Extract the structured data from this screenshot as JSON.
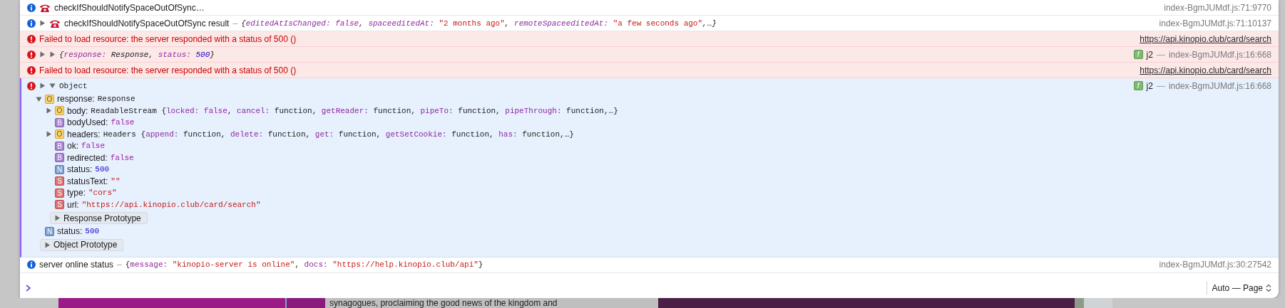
{
  "messages": [
    {
      "kind": "info-emblem",
      "selected": false,
      "label": "checkIfShouldNotifySpaceOutOfSync…",
      "source": {
        "kind": "location",
        "text": "index-BgmJUMdf.js:71:9770"
      }
    },
    {
      "kind": "info-emblem",
      "selected": false,
      "expanded": false,
      "label": "checkIfShouldNotifySpaceOutOfSync result",
      "separator": "–",
      "italic": true,
      "preview": [
        {
          "kind": "punct",
          "text": "{"
        },
        {
          "kind": "key",
          "text": "editedAtIsChanged:"
        },
        {
          "kind": "keyword",
          "text": "false"
        },
        {
          "kind": "punct",
          "text": ","
        },
        {
          "kind": "key",
          "text": "spaceeditedAt:"
        },
        {
          "kind": "string",
          "text": "\"2 months ago\""
        },
        {
          "kind": "punct",
          "text": ","
        },
        {
          "kind": "key",
          "text": "remoteSpaceeditedAt:"
        },
        {
          "kind": "string",
          "text": "\"a few seconds ago\""
        },
        {
          "kind": "punct",
          "text": ","
        },
        {
          "kind": "punct",
          "text": "…}"
        }
      ],
      "source": {
        "kind": "location",
        "text": "index-BgmJUMdf.js:71:10137"
      }
    },
    {
      "kind": "error",
      "selected": false,
      "label": "Failed to load resource: the server responded with a status of 500 ()",
      "source": {
        "kind": "link",
        "text": "https://api.kinopio.club/card/search"
      }
    },
    {
      "kind": "error",
      "selected": false,
      "trace_expanded": false,
      "expanded": false,
      "italic": true,
      "preview": [
        {
          "kind": "punct",
          "text": "{"
        },
        {
          "kind": "key",
          "text": "response:"
        },
        {
          "kind": "type",
          "text": "Response"
        },
        {
          "kind": "punct",
          "text": ","
        },
        {
          "kind": "key",
          "text": "status:"
        },
        {
          "kind": "number",
          "text": "500"
        },
        {
          "kind": "punct",
          "text": "}"
        }
      ],
      "source": {
        "kind": "location",
        "badge": "f",
        "function": "j2",
        "separator": "—",
        "text": "index-BgmJUMdf.js:16:668"
      }
    },
    {
      "kind": "error",
      "selected": false,
      "label": "Failed to load resource: the server responded with a status of 500 ()",
      "source": {
        "kind": "link",
        "text": "https://api.kinopio.club/card/search"
      }
    },
    {
      "kind": "error",
      "selected": true,
      "trace_expanded": false,
      "object": {
        "label": "Object",
        "expanded": true,
        "properties": [
          {
            "badge": "O",
            "kind": "object",
            "key": "response:",
            "value": [
              {
                "kind": "type",
                "text": "Response"
              }
            ],
            "expanded": true,
            "children": [
              {
                "badge": "O",
                "kind": "object",
                "key": "body:",
                "expanded": false,
                "value": [
                  {
                    "kind": "type",
                    "text": "ReadableStream"
                  },
                  {
                    "kind": "punct",
                    "text": "{"
                  },
                  {
                    "kind": "key",
                    "text": "locked:"
                  },
                  {
                    "kind": "keyword",
                    "text": "false"
                  },
                  {
                    "kind": "punct",
                    "text": ","
                  },
                  {
                    "kind": "key",
                    "text": "cancel:"
                  },
                  {
                    "kind": "type",
                    "text": "function"
                  },
                  {
                    "kind": "punct",
                    "text": ","
                  },
                  {
                    "kind": "key",
                    "text": "getReader:"
                  },
                  {
                    "kind": "type",
                    "text": "function"
                  },
                  {
                    "kind": "punct",
                    "text": ","
                  },
                  {
                    "kind": "key",
                    "text": "pipeTo:"
                  },
                  {
                    "kind": "type",
                    "text": "function"
                  },
                  {
                    "kind": "punct",
                    "text": ","
                  },
                  {
                    "kind": "key",
                    "text": "pipeThrough:"
                  },
                  {
                    "kind": "type",
                    "text": "function"
                  },
                  {
                    "kind": "punct",
                    "text": ","
                  },
                  {
                    "kind": "punct",
                    "text": "…}"
                  }
                ]
              },
              {
                "badge": "B",
                "kind": "boolean",
                "key": "bodyUsed:",
                "value": [
                  {
                    "kind": "keyword",
                    "text": "false"
                  }
                ]
              },
              {
                "badge": "O",
                "kind": "object",
                "key": "headers:",
                "expanded": false,
                "value": [
                  {
                    "kind": "type",
                    "text": "Headers"
                  },
                  {
                    "kind": "punct",
                    "text": "{"
                  },
                  {
                    "kind": "key",
                    "text": "append:"
                  },
                  {
                    "kind": "type",
                    "text": "function"
                  },
                  {
                    "kind": "punct",
                    "text": ","
                  },
                  {
                    "kind": "key",
                    "text": "delete:"
                  },
                  {
                    "kind": "type",
                    "text": "function"
                  },
                  {
                    "kind": "punct",
                    "text": ","
                  },
                  {
                    "kind": "key",
                    "text": "get:"
                  },
                  {
                    "kind": "type",
                    "text": "function"
                  },
                  {
                    "kind": "punct",
                    "text": ","
                  },
                  {
                    "kind": "key",
                    "text": "getSetCookie:"
                  },
                  {
                    "kind": "type",
                    "text": "function"
                  },
                  {
                    "kind": "punct",
                    "text": ","
                  },
                  {
                    "kind": "key",
                    "text": "has:"
                  },
                  {
                    "kind": "type",
                    "text": "function"
                  },
                  {
                    "kind": "punct",
                    "text": ","
                  },
                  {
                    "kind": "punct",
                    "text": "…}"
                  }
                ]
              },
              {
                "badge": "B",
                "kind": "boolean",
                "key": "ok:",
                "value": [
                  {
                    "kind": "keyword",
                    "text": "false"
                  }
                ]
              },
              {
                "badge": "B",
                "kind": "boolean",
                "key": "redirected:",
                "value": [
                  {
                    "kind": "keyword",
                    "text": "false"
                  }
                ]
              },
              {
                "badge": "N",
                "kind": "number",
                "key": "status:",
                "value": [
                  {
                    "kind": "number",
                    "text": "500"
                  }
                ]
              },
              {
                "badge": "S",
                "kind": "string",
                "key": "statusText:",
                "value": [
                  {
                    "kind": "string",
                    "text": "\"\""
                  }
                ]
              },
              {
                "badge": "S",
                "kind": "string",
                "key": "type:",
                "value": [
                  {
                    "kind": "string",
                    "text": "\"cors\""
                  }
                ]
              },
              {
                "badge": "S",
                "kind": "string",
                "key": "url:",
                "value": [
                  {
                    "kind": "string",
                    "text": "\"https://api.kinopio.club/card/search\""
                  }
                ]
              }
            ],
            "prototype": {
              "label": "Response Prototype",
              "expanded": false
            }
          },
          {
            "badge": "N",
            "kind": "number",
            "key": "status:",
            "value": [
              {
                "kind": "number",
                "text": "500"
              }
            ]
          }
        ],
        "prototype": {
          "label": "Object Prototype",
          "expanded": false
        }
      },
      "source": {
        "kind": "location",
        "badge": "f",
        "function": "j2",
        "separator": "—",
        "text": "index-BgmJUMdf.js:16:668"
      }
    },
    {
      "kind": "info",
      "selected": false,
      "label": "server online status",
      "separator": "–",
      "italic": false,
      "preview": [
        {
          "kind": "punct",
          "text": "{"
        },
        {
          "kind": "key",
          "text": "message:"
        },
        {
          "kind": "string",
          "text": "\"kinopio-server is online\""
        },
        {
          "kind": "punct",
          "text": ","
        },
        {
          "kind": "key",
          "text": "docs:"
        },
        {
          "kind": "string",
          "text": "\"https://help.kinopio.club/api\""
        },
        {
          "kind": "punct",
          "text": "}"
        }
      ],
      "source": {
        "kind": "location",
        "text": "index-BgmJUMdf.js:30:27542"
      }
    }
  ],
  "context_selector": {
    "label": "Auto — Page"
  },
  "backdrop_text": "synagogues, proclaiming the good news of the kingdom and"
}
